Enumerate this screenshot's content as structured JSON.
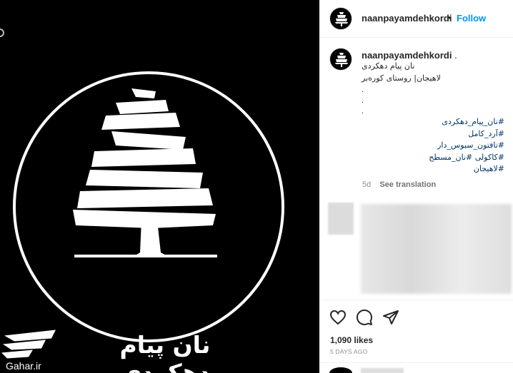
{
  "media": {
    "brand_text": "نان پیام دهکردی",
    "watermark_text": "Gahar.ir"
  },
  "post": {
    "header": {
      "username": "naanpayamdehkordi",
      "separator": "•",
      "follow_label": "Follow"
    },
    "caption": {
      "username": "naanpayamdehkordi",
      "username_suffix": ".",
      "lines": [
        "نان پیام دهکردی",
        "لاهیجان| روستای کوره‌بر"
      ],
      "dots": [
        ".",
        ".",
        "."
      ],
      "hashtags": [
        "#نان_پیام_دهکردی",
        "#آرد_کامل",
        "#تافتون_سبوس_دار",
        "#کاکولی #نان_مسطح",
        "#لاهیجان"
      ]
    },
    "meta": {
      "age": "5d",
      "see_translation": "See translation"
    },
    "likes": "1,090 likes",
    "time_ago": "5 DAYS AGO"
  },
  "icons": [
    "heart-icon",
    "comment-icon",
    "share-icon",
    "tree-logo-icon",
    "gahar-logo-icon"
  ],
  "colors": {
    "accent": "#0095f6",
    "hashtag": "#00376b",
    "text": "#262626",
    "muted": "#8e8e8e",
    "media_bg": "#000000"
  }
}
